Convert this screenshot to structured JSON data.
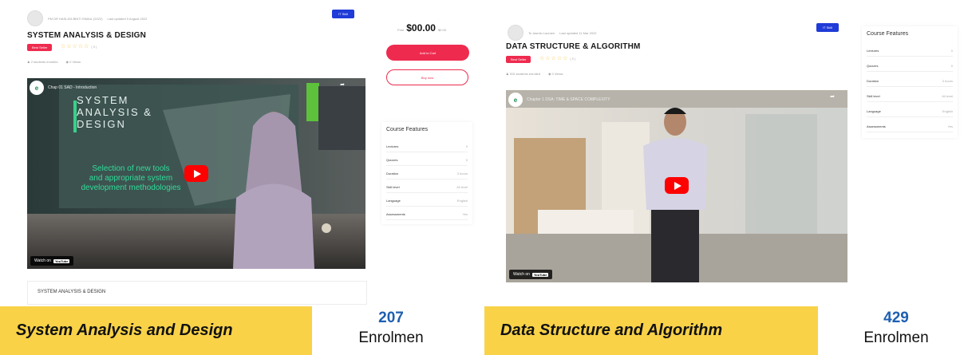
{
  "courses": [
    {
      "author": "PM DR HASLIZA BINTI ISMAIL (2022)",
      "updated": "Last updated 9 August 2022",
      "category": "IT Skill",
      "title": "SYSTEM ANALYSIS & DESIGN",
      "tag": "Best Seller",
      "rating_count": "(0)",
      "students": "2 students enrolled",
      "views": "0 Views",
      "video_title": "Chap 01 SAD - Introduction",
      "video_overlay": [
        "SYSTEM",
        "ANALYSIS &",
        "DESIGN"
      ],
      "video_caption": [
        "Selection of new tools",
        "and appropriate system",
        "development methodologies"
      ],
      "watch_on": "Watch on",
      "youtube": "YouTube",
      "bottom_title": "SYSTEM ANALYSIS & DESIGN",
      "price_prefix": "Free",
      "price": "$00.00",
      "price_suffix": "$0.00",
      "add_to_cart": "Add to Cart",
      "buy_now": "Buy now",
      "features_title": "Course Features",
      "features": [
        {
          "label": "Lectures",
          "value": "0"
        },
        {
          "label": "Quizzes",
          "value": "0"
        },
        {
          "label": "Duration",
          "value": "3 hours"
        },
        {
          "label": "Skill level",
          "value": "All level"
        },
        {
          "label": "Language",
          "value": "English"
        },
        {
          "label": "Assessments",
          "value": "Yes"
        }
      ],
      "caption": "System Analysis and Design",
      "enrol_count": "207",
      "enrol_label": "Enrolmen"
    },
    {
      "author": "Ts Jasmin Lacmen",
      "updated": "Last updated 11 Mar 2022",
      "category": "IT Skill",
      "title": "DATA STRUCTURE & ALGORITHM",
      "tag": "Best Seller",
      "rating_count": "(0)",
      "students": "515 students enrolled",
      "views": "0 Views",
      "video_title": "Chapter 1 DSA: TIME & SPACE COMPLEXITY",
      "watch_on": "Watch on",
      "youtube": "YouTube",
      "features_title": "Course Features",
      "features": [
        {
          "label": "Lectures",
          "value": "0"
        },
        {
          "label": "Quizzes",
          "value": "0"
        },
        {
          "label": "Duration",
          "value": "3 hours"
        },
        {
          "label": "Skill level",
          "value": "All level"
        },
        {
          "label": "Language",
          "value": "English"
        },
        {
          "label": "Assessments",
          "value": "Yes"
        }
      ],
      "caption": "Data Structure and Algorithm",
      "enrol_count": "429",
      "enrol_label": "Enrolmen"
    }
  ],
  "colors": {
    "accent": "#ee2b4f",
    "category": "#1f3bd8",
    "caption_bg": "#f9d248",
    "enrol_num": "#1e5fb0"
  }
}
